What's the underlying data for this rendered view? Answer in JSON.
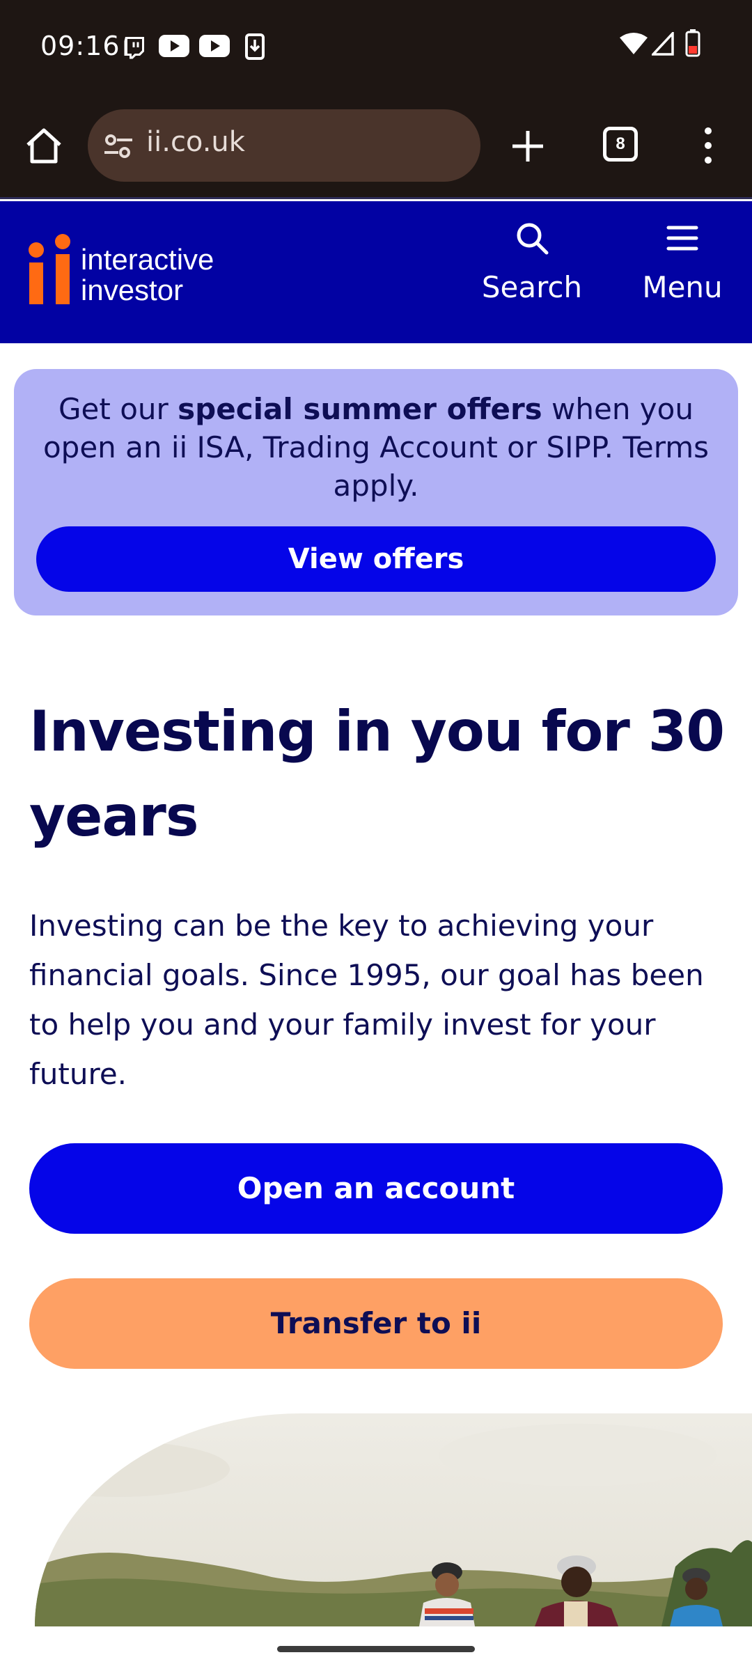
{
  "status_bar": {
    "time": "09:16",
    "notification_icons": [
      "twitch-icon",
      "youtube-icon",
      "youtube-icon",
      "download-icon"
    ],
    "system_icons": [
      "wifi-icon",
      "signal-icon",
      "battery-icon"
    ]
  },
  "browser": {
    "url": "ii.co.uk",
    "tab_count": "8"
  },
  "site_header": {
    "logo_line1": "interactive",
    "logo_line2": "investor",
    "search_label": "Search",
    "menu_label": "Menu"
  },
  "promo": {
    "text_before": "Get our ",
    "text_bold": "special summer offers",
    "text_after": " when you open an ii ISA, Trading Account or SIPP. Terms apply.",
    "button_label": "View offers"
  },
  "hero": {
    "title": "Investing in you for 30 years",
    "body": "Investing can be the key to achieving your financial goals. Since 1995, our goal has been to help you and your family invest for your future.",
    "primary_button": "Open an account",
    "secondary_button": "Transfer to ii"
  },
  "colors": {
    "header_bg": "#0202a3",
    "accent_blue": "#0505e8",
    "accent_orange": "#fea064",
    "promo_bg": "#b1b1f6",
    "text_navy": "#08084f"
  }
}
